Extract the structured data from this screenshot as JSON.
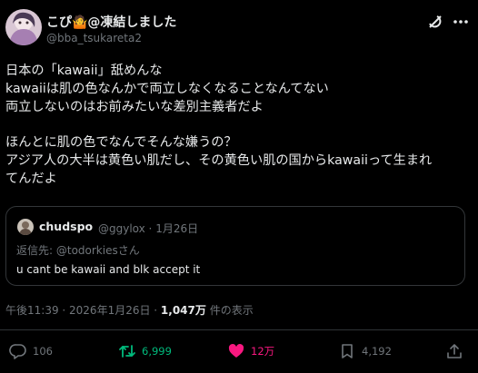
{
  "author": {
    "display_name": "こぴ🤷@凍結しました",
    "handle": "@bba_tsukareta2"
  },
  "icons": {
    "grok": "grok-icon",
    "more": "more-icon",
    "reply": "reply-icon",
    "retweet": "retweet-icon",
    "like": "heart-icon",
    "bookmark": "bookmark-icon",
    "share": "share-icon"
  },
  "post": {
    "lines": [
      "日本の「kawaii」舐めんな",
      "kawaiiは肌の色なんかで両立しなくなることなんてない",
      "両立しないのはお前みたいな差別主義者だよ",
      "",
      "ほんとに肌の色でなんでそんな嫌うの？",
      "アジア人の大半は黄色い肌だし、その黄色い肌の国からkawaiiって生まれ",
      "てんだよ"
    ]
  },
  "quote": {
    "display_name": "chudspo",
    "handle_date": "@ggylox · 1月26日",
    "reply_prefix": "返信先: ",
    "reply_mention": "@todorkiesさん",
    "text": "u cant be kawaii and blk accept it"
  },
  "meta": {
    "timestamp": "午後11:39 · 2026年1月26日 · ",
    "views_count": "1,047万",
    "views_label": " 件の表示"
  },
  "actions": {
    "reply_count": "106",
    "retweet_count": "6,999",
    "like_count": "12万",
    "bookmark_count": "4,192"
  },
  "colors": {
    "background": "#000000",
    "text": "#e7e9ea",
    "secondary": "#71767b",
    "retweet_active": "#00ba7c",
    "like_active": "#f91880",
    "border": "#333639"
  }
}
